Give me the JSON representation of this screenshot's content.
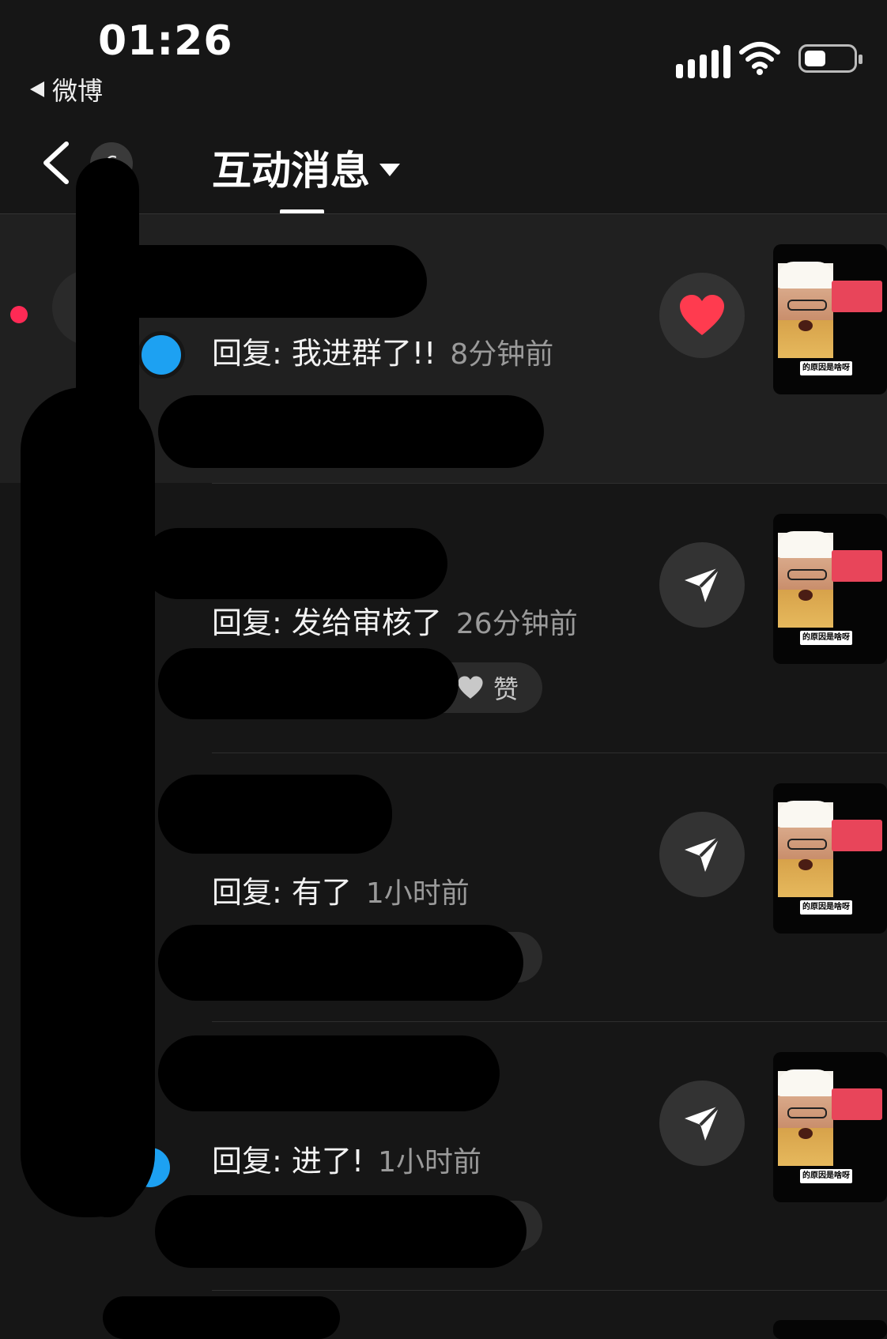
{
  "status_bar": {
    "time": "01:26",
    "back_app": "微博"
  },
  "header": {
    "title": "互动消息",
    "badge": "6"
  },
  "messages": [
    {
      "text": "回复: 我进群了!!",
      "time": "8分钟前",
      "unread": true,
      "action": "heart-icon",
      "pill": "",
      "thumb_caption": "的原因是啥呀"
    },
    {
      "text": "回复: 发给审核了",
      "time": "26分钟前",
      "unread": false,
      "action": "send-icon",
      "pill": "赞",
      "thumb_caption": "的原因是啥呀"
    },
    {
      "text": "回复: 有了",
      "time": "1小时前",
      "unread": false,
      "action": "send-icon",
      "pill": "",
      "thumb_caption": "的原因是啥呀"
    },
    {
      "text": "回复: 进了!",
      "time": "1小时前",
      "unread": false,
      "action": "send-icon",
      "pill": "",
      "thumb_caption": "的原因是啥呀"
    }
  ],
  "colors": {
    "background": "#161616",
    "unread_dot": "#ff2a55",
    "heart": "#ff3b4f",
    "verify_badge": "#1da1f2"
  }
}
